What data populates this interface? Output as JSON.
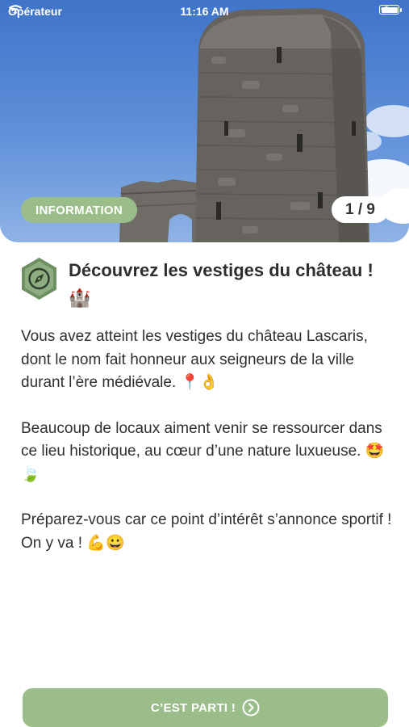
{
  "status_bar": {
    "carrier": "Opérateur",
    "time": "11:16 AM",
    "icons": [
      "wifi-icon",
      "location-arrow-icon",
      "battery-icon"
    ]
  },
  "hero": {
    "category_label": "INFORMATION",
    "counter": "1 / 9"
  },
  "content": {
    "icon": "compass-hexagon-icon",
    "title": "Découvrez les vestiges du château ! 🏰",
    "paragraphs": [
      "Vous avez atteint les vestiges du château Lascaris, dont le nom fait honneur aux seigneurs de la ville durant l’ère médiévale. 📍👌",
      "Beaucoup de locaux aiment venir se ressourcer dans ce lieu historique, au cœur d’une nature luxueuse. 🤩 🍃",
      "Préparez-vous car ce point d’intérêt s’annonce sportif !\nOn y va ! 💪😀"
    ]
  },
  "cta": {
    "label": "C’EST PARTI !",
    "icon": "chevron-right-circle-icon"
  },
  "colors": {
    "accent": "#9bbd8a",
    "poi_icon_fill": "#6d8f62",
    "text": "#2f2f2f"
  }
}
